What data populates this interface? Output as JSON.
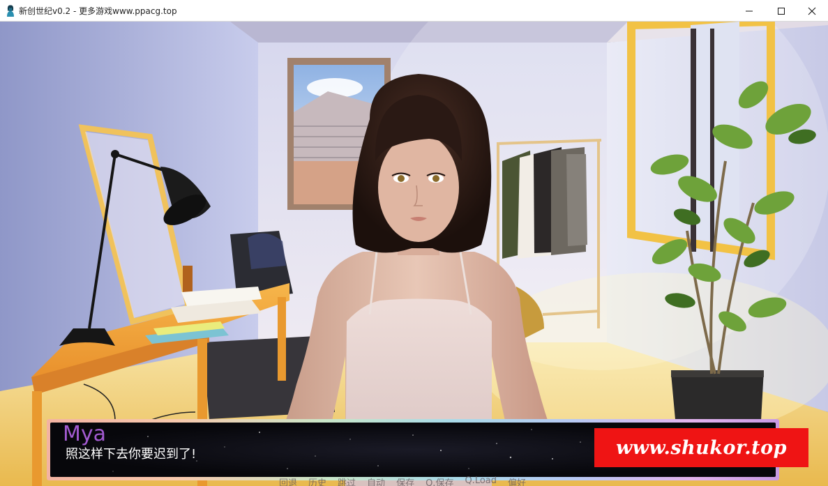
{
  "window": {
    "title": "新创世纪v0.2 - 更多游戏www.ppacg.top",
    "icon": "character-silhouette-icon",
    "controls": {
      "minimize_icon": "minimize-icon",
      "maximize_icon": "maximize-icon",
      "close_icon": "close-icon"
    }
  },
  "scene": {
    "location": "bedroom",
    "character": "Mya"
  },
  "dialogue": {
    "speaker": "Mya",
    "text": "照这样下去你要迟到了!",
    "name_color": "#a25ad0"
  },
  "quick_menu": {
    "items": [
      "回退",
      "历史",
      "跳过",
      "自动",
      "保存",
      "Q.保存",
      "Q.Load",
      "偏好"
    ]
  },
  "watermark": {
    "text": "www.shukor.top",
    "color": "#ef1414"
  }
}
